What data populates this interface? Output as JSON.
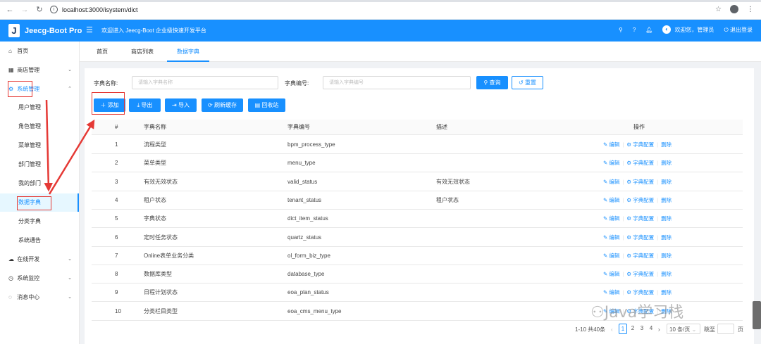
{
  "browser": {
    "url": "localhost:3000/isystem/dict"
  },
  "header": {
    "logo_letter": "J",
    "app_name": "Jeecg-Boot Pro",
    "welcome": "欢迎进入 Jeecg-Boot 企业级快速开发平台",
    "user_greeting": "欢迎您，管理员",
    "logout": "退出登录"
  },
  "sidebar": {
    "items": [
      {
        "label": "首页"
      },
      {
        "label": "商店管理"
      },
      {
        "label": "系统管理"
      },
      {
        "label": "用户管理"
      },
      {
        "label": "角色管理"
      },
      {
        "label": "菜单管理"
      },
      {
        "label": "部门管理"
      },
      {
        "label": "我的部门"
      },
      {
        "label": "数据字典"
      },
      {
        "label": "分类字典"
      },
      {
        "label": "系统通告"
      },
      {
        "label": "在线开发"
      },
      {
        "label": "系统监控"
      },
      {
        "label": "消息中心"
      }
    ]
  },
  "tabs": [
    {
      "label": "首页"
    },
    {
      "label": "商店列表"
    },
    {
      "label": "数据字典"
    }
  ],
  "search": {
    "name_label": "字典名称:",
    "name_placeholder": "请输入字典名称",
    "code_label": "字典编号:",
    "code_placeholder": "请输入字典编号",
    "query": "查询",
    "reset": "重置"
  },
  "toolbar": {
    "add": "添加",
    "export": "导出",
    "import": "导入",
    "refresh": "刷新缓存",
    "recycle": "回收站"
  },
  "table": {
    "columns": [
      "#",
      "字典名称",
      "字典编号",
      "描述",
      "操作"
    ],
    "rows": [
      {
        "no": "1",
        "name": "流程类型",
        "code": "bpm_process_type",
        "desc": ""
      },
      {
        "no": "2",
        "name": "菜单类型",
        "code": "menu_type",
        "desc": ""
      },
      {
        "no": "3",
        "name": "有效无效状态",
        "code": "valid_status",
        "desc": "有效无效状态"
      },
      {
        "no": "4",
        "name": "租户状态",
        "code": "tenant_status",
        "desc": "租户状态"
      },
      {
        "no": "5",
        "name": "字典状态",
        "code": "dict_item_status",
        "desc": ""
      },
      {
        "no": "6",
        "name": "定时任务状态",
        "code": "quartz_status",
        "desc": ""
      },
      {
        "no": "7",
        "name": "Online表单业务分类",
        "code": "ol_form_biz_type",
        "desc": ""
      },
      {
        "no": "8",
        "name": "数据库类型",
        "code": "database_type",
        "desc": ""
      },
      {
        "no": "9",
        "name": "日程计划状态",
        "code": "eoa_plan_status",
        "desc": ""
      },
      {
        "no": "10",
        "name": "分类栏目类型",
        "code": "eoa_cms_menu_type",
        "desc": ""
      }
    ],
    "actions": {
      "edit": "编辑",
      "config": "字典配置",
      "delete": "删除"
    }
  },
  "pagination": {
    "summary": "1-10 共40条",
    "pages": [
      "1",
      "2",
      "3",
      "4"
    ],
    "current": "1",
    "page_size": "10 条/页",
    "goto_label": "跳至",
    "page_suffix": "页"
  },
  "watermark": "Java学习栈",
  "colors": {
    "primary": "#1890ff",
    "annotation_red": "#e53935"
  }
}
